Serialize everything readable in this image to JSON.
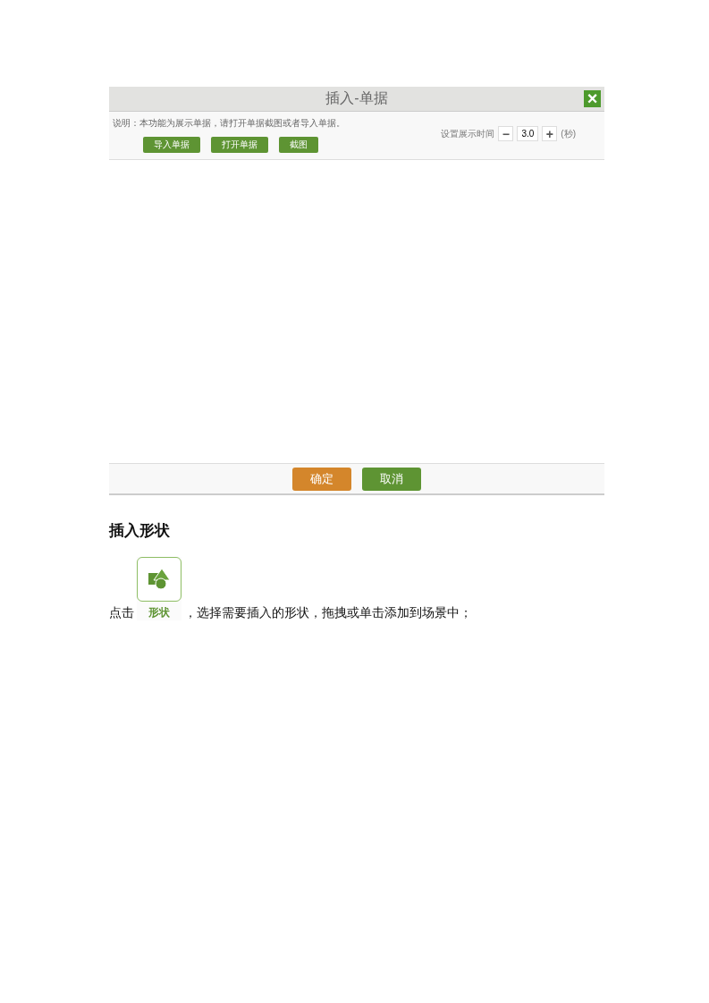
{
  "dialog": {
    "title": "插入-单据",
    "close": "×",
    "note": "说明：本功能为展示单据，请打开单据截图或者导入单据。",
    "actions": [
      "导入单据",
      "打开单据",
      "截图"
    ],
    "duration": {
      "label": "设置展示时间",
      "minus": "−",
      "value": "3.0",
      "plus": "+",
      "unit": "(秒)"
    },
    "footer": [
      {
        "label": "确定",
        "kind": "primary"
      },
      {
        "label": "取消",
        "kind": "secondary"
      }
    ]
  },
  "section": {
    "heading": "插入形状",
    "intro": "点击",
    "tool": {
      "label": "形状"
    },
    "text": "，选择需要插入的形状，拖拽或单击添加到场景中；"
  }
}
